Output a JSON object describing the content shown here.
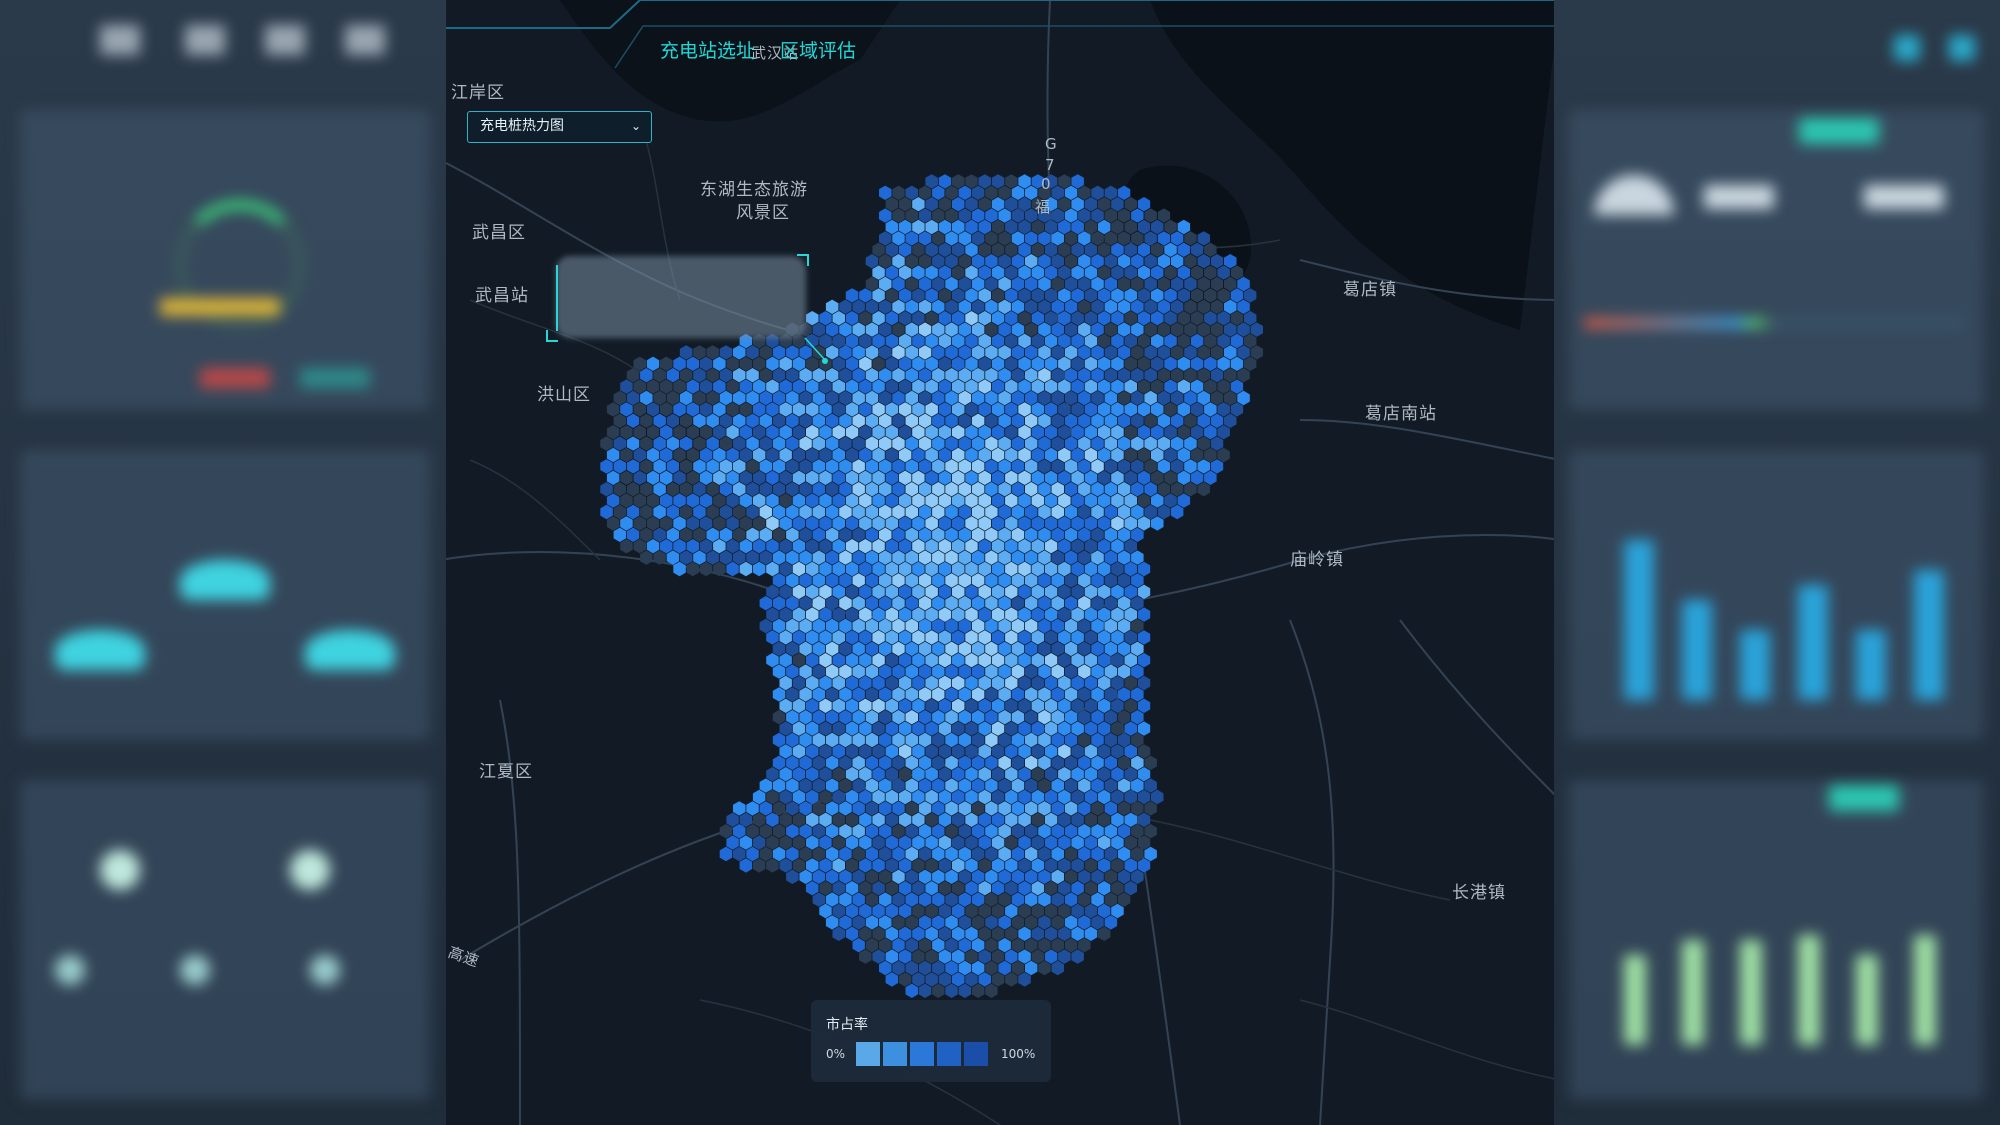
{
  "header": {
    "tabs": [
      {
        "label": "充电站选址"
      },
      {
        "label": "区域评估"
      }
    ]
  },
  "layer_select": {
    "value": "充电桩热力图"
  },
  "map": {
    "place_labels": [
      "江岸区",
      "武汉站",
      "东湖生态旅游",
      "风景区",
      "武昌区",
      "武昌站",
      "洪山区",
      "江夏区",
      "葛店镇",
      "葛店南站",
      "庙岭镇",
      "长港镇",
      "高速",
      "G",
      "7",
      "0",
      "福"
    ]
  },
  "legend": {
    "title": "市占率",
    "min_label": "0%",
    "max_label": "100%",
    "colors": [
      "#5aa8e8",
      "#3d8fe0",
      "#2b78d8",
      "#1f62c4",
      "#1a4ea8"
    ]
  },
  "colors": {
    "accent": "#22d6d6",
    "hex_empty": "#2b3d52",
    "hex_levels": [
      "#1f4f9a",
      "#1f6ad6",
      "#2f8cf0",
      "#5cacf4",
      "#8fcaf8"
    ]
  }
}
